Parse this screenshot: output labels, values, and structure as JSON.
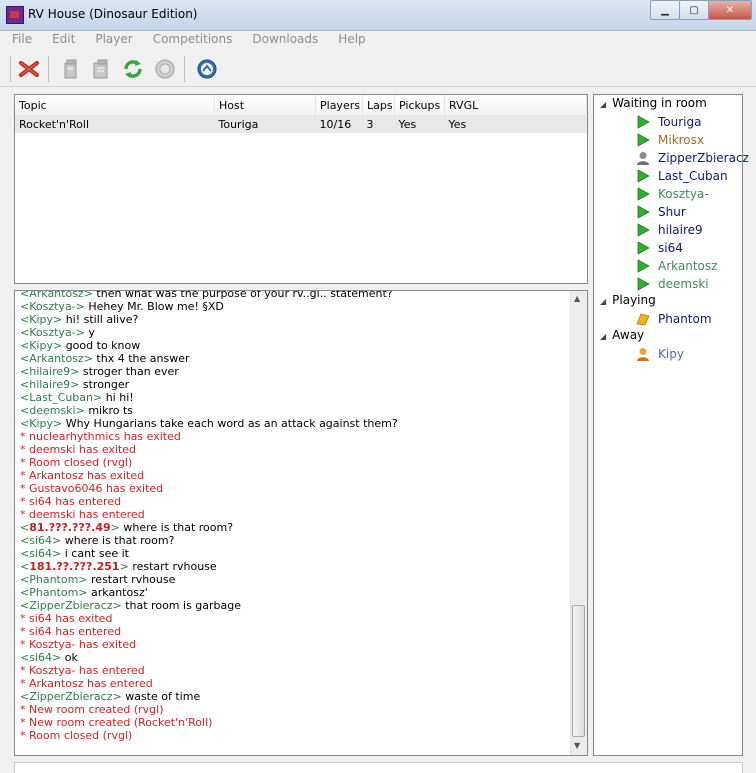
{
  "window": {
    "title": "RV House (Dinosaur Edition)",
    "buttons": [
      "▁",
      "▢",
      "✕"
    ]
  },
  "menu": [
    "File",
    "Edit",
    "Player",
    "Competitions",
    "Downloads",
    "Help"
  ],
  "toolbar": {
    "icons": [
      "disconnect-icon",
      "host-room-icon",
      "join-room-icon",
      "refresh-icon",
      "leave-icon",
      "settings-icon"
    ]
  },
  "rooms": {
    "columns": [
      "Topic",
      "Host",
      "Players",
      "Laps",
      "Pickups",
      "RVGL"
    ],
    "rows": [
      [
        "Rocket'n'Roll",
        "Touriga",
        "10/16",
        "3",
        "Yes",
        "Yes"
      ]
    ]
  },
  "chat": [
    {
      "type": "msg",
      "nick": "Arkantosz",
      "text": "then what was the purpose of your rv..gl.. statement?"
    },
    {
      "type": "msg",
      "nick": "Kosztya-",
      "text": "Hehey Mr. Blow me! §XD"
    },
    {
      "type": "msg",
      "nick": "Kipy",
      "text": "hi! still alive?"
    },
    {
      "type": "msg",
      "nick": "Kosztya-",
      "text": "y"
    },
    {
      "type": "msg",
      "nick": "Kipy",
      "text": "good to know"
    },
    {
      "type": "msg",
      "nick": "Arkantosz",
      "text": "thx 4 the answer"
    },
    {
      "type": "msg",
      "nick": "hilaire9",
      "text": "stroger than ever"
    },
    {
      "type": "msg",
      "nick": "hilaire9",
      "text": "stronger"
    },
    {
      "type": "msg",
      "nick": "Last_Cuban",
      "text": "hi hi!"
    },
    {
      "type": "msg",
      "nick": "deemski",
      "text": "mikro ts"
    },
    {
      "type": "msg",
      "nick": "Kipy",
      "text": "Why Hungarians take each word as an attack against them?"
    },
    {
      "type": "sys",
      "text": "* nuclearhythmics has exited"
    },
    {
      "type": "sys",
      "text": "* deemski has exited"
    },
    {
      "type": "sys",
      "text": "* Room closed (rvgl)"
    },
    {
      "type": "sys",
      "text": "* Arkantosz has exited"
    },
    {
      "type": "sys",
      "text": "* Gustavo6046 has exited"
    },
    {
      "type": "sys",
      "text": "* si64 has entered"
    },
    {
      "type": "sys",
      "text": "* deemski has entered"
    },
    {
      "type": "ip",
      "nick": "81.???.???.49",
      "text": "where is that room?"
    },
    {
      "type": "msg",
      "nick": "si64",
      "text": "where is that room?"
    },
    {
      "type": "msg",
      "nick": "si64",
      "text": "i cant see it"
    },
    {
      "type": "ip",
      "nick": "181.??.???.251",
      "text": "restart rvhouse"
    },
    {
      "type": "msg",
      "nick": "Phantom",
      "text": "restart rvhouse"
    },
    {
      "type": "msg",
      "nick": "Phantom",
      "text": "arkantosz'"
    },
    {
      "type": "msg",
      "nick": "ZipperZbieracz",
      "text": "that room is garbage"
    },
    {
      "type": "sys",
      "text": "* si64 has exited"
    },
    {
      "type": "sys",
      "text": "* si64 has entered"
    },
    {
      "type": "sys",
      "text": "* Kosztya- has exited"
    },
    {
      "type": "msg",
      "nick": "si64",
      "text": "ok"
    },
    {
      "type": "sys",
      "text": "* Kosztya- has entered"
    },
    {
      "type": "sys",
      "text": "* Arkantosz has entered"
    },
    {
      "type": "msg",
      "nick": "ZipperZbieracz",
      "text": "waste of time"
    },
    {
      "type": "sys",
      "text": "* New room created (rvgl)"
    },
    {
      "type": "sys",
      "text": "* New room created (Rocket'n'Roll)"
    },
    {
      "type": "sys",
      "text": "* Room closed (rvgl)"
    }
  ],
  "users": {
    "groups": [
      {
        "label": "Waiting in room",
        "members": [
          {
            "name": "Touriga",
            "icon": "play-icon",
            "color": "#0a1a6e"
          },
          {
            "name": "Mikrosx",
            "icon": "play-icon",
            "color": "#a66a1e"
          },
          {
            "name": "ZipperZbieracz",
            "icon": "user-gray-icon",
            "color": "#0a1a6e"
          },
          {
            "name": "Last_Cuban",
            "icon": "play-icon",
            "color": "#0a1a6e"
          },
          {
            "name": "Kosztya-",
            "icon": "play-icon",
            "color": "#3f8a5a"
          },
          {
            "name": "Shur",
            "icon": "play-icon",
            "color": "#0a1a6e"
          },
          {
            "name": "hilaire9",
            "icon": "play-icon",
            "color": "#0a1a6e"
          },
          {
            "name": "si64",
            "icon": "play-icon",
            "color": "#0a1a6e"
          },
          {
            "name": "Arkantosz",
            "icon": "play-icon",
            "color": "#3f8a5a"
          },
          {
            "name": "deemski",
            "icon": "play-icon",
            "color": "#3f8a5a"
          }
        ]
      },
      {
        "label": "Playing",
        "members": [
          {
            "name": "Phantom",
            "icon": "racing-icon",
            "color": "#0a1a6e"
          }
        ]
      },
      {
        "label": "Away",
        "members": [
          {
            "name": "Kipy",
            "icon": "user-orange-icon",
            "color": "#4a6ab0"
          }
        ]
      }
    ]
  }
}
